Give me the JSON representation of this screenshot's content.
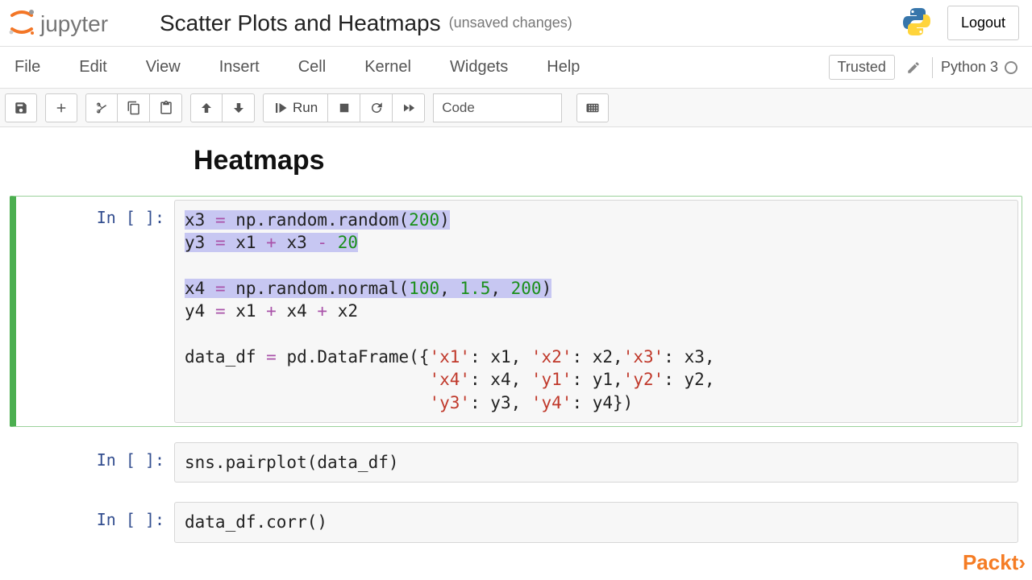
{
  "header": {
    "logo_text": "jupyter",
    "title": "Scatter Plots and Heatmaps",
    "unsaved": "(unsaved changes)",
    "logout": "Logout"
  },
  "menubar": {
    "items": [
      "File",
      "Edit",
      "View",
      "Insert",
      "Cell",
      "Kernel",
      "Widgets",
      "Help"
    ],
    "trusted": "Trusted",
    "kernel": "Python 3"
  },
  "toolbar": {
    "run_label": "Run",
    "cell_type": "Code"
  },
  "content": {
    "heading": "Heatmaps",
    "prompt": "In [ ]:",
    "cell1": {
      "l1a": "x3 ",
      "l1b": "=",
      "l1c": " np.random.random(",
      "l1d": "200",
      "l1e": ")",
      "l2a": "y3 ",
      "l2b": "=",
      "l2c": " x1 ",
      "l2d": "+",
      "l2e": " x3 ",
      "l2f": "-",
      "l2g": " ",
      "l2h": "20",
      "l3": "",
      "l4a": "x4 ",
      "l4b": "=",
      "l4c": " np.random.normal(",
      "l4d": "100",
      "l4e": ", ",
      "l4f": "1.5",
      "l4g": ", ",
      "l4h": "200",
      "l4i": ")",
      "l5a": "y4 ",
      "l5b": "=",
      "l5c": " x1 ",
      "l5d": "+",
      "l5e": " x4 ",
      "l5f": "+",
      "l5g": " x2",
      "l6": "",
      "l7a": "data_df ",
      "l7b": "=",
      "l7c": " pd.DataFrame({",
      "l7d": "'x1'",
      "l7e": ": x1, ",
      "l7f": "'x2'",
      "l7g": ": x2,",
      "l7h": "'x3'",
      "l7i": ": x3,",
      "l8a": "                        ",
      "l8b": "'x4'",
      "l8c": ": x4, ",
      "l8d": "'y1'",
      "l8e": ": y1,",
      "l8f": "'y2'",
      "l8g": ": y2,",
      "l9a": "                        ",
      "l9b": "'y3'",
      "l9c": ": y3, ",
      "l9d": "'y4'",
      "l9e": ": y4})"
    },
    "cell2": "sns.pairplot(data_df)",
    "cell3": "data_df.corr()"
  },
  "watermark": "Packt›"
}
